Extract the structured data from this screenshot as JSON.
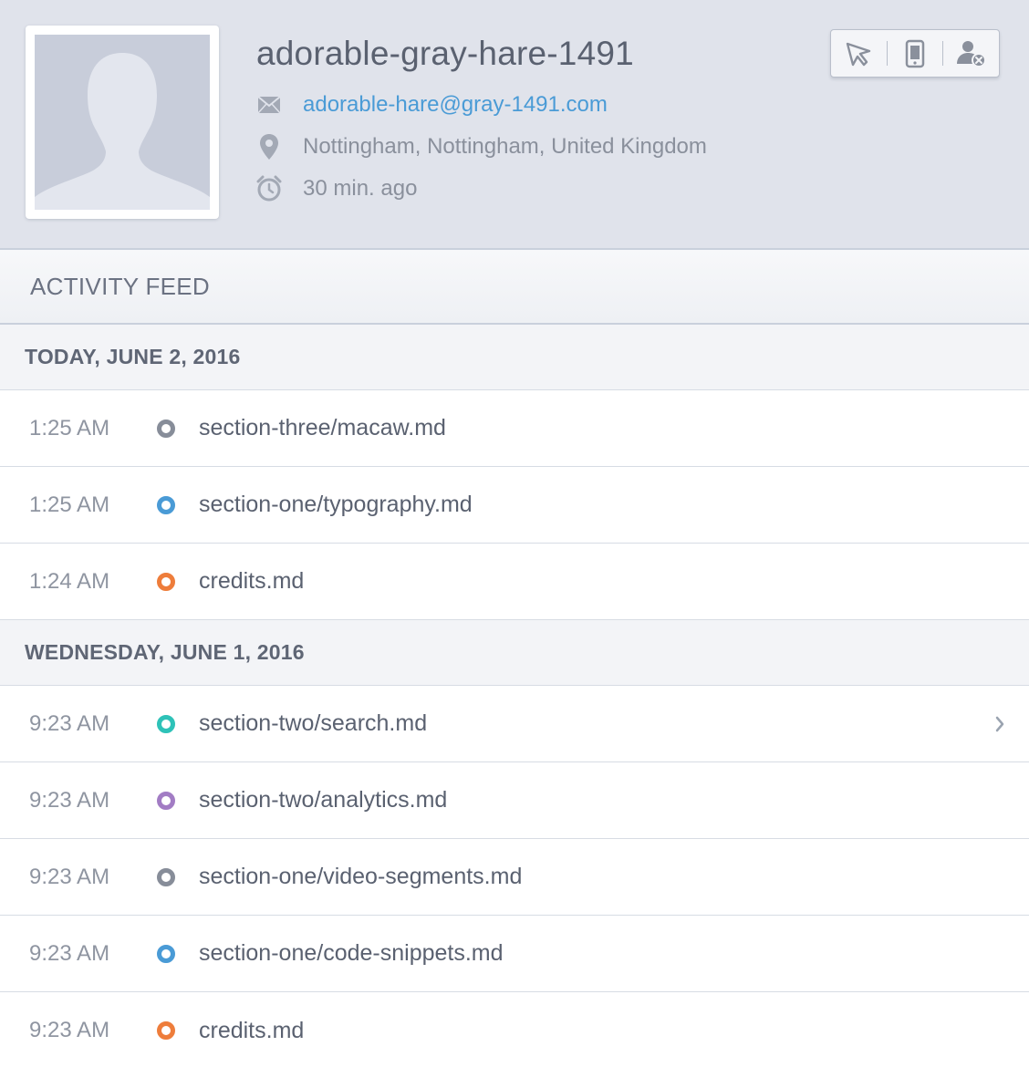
{
  "profile": {
    "name": "adorable-gray-hare-1491",
    "email": "adorable-hare@gray-1491.com",
    "location": "Nottingham, Nottingham, United Kingdom",
    "last_seen": "30 min. ago",
    "avatar_icon": "person-silhouette-icon",
    "toolbar": [
      {
        "icon": "send-cursor-icon"
      },
      {
        "icon": "mobile-device-icon"
      },
      {
        "icon": "remove-user-icon"
      }
    ]
  },
  "feed": {
    "title": "ACTIVITY FEED",
    "days": [
      {
        "label": "TODAY, JUNE 2, 2016",
        "items": [
          {
            "time": "1:25 AM",
            "file": "section-three/macaw.md",
            "dot_color": "#878d99"
          },
          {
            "time": "1:25 AM",
            "file": "section-one/typography.md",
            "dot_color": "#4a9bd6"
          },
          {
            "time": "1:24 AM",
            "file": "credits.md",
            "dot_color": "#ee7d3b"
          }
        ]
      },
      {
        "label": "WEDNESDAY, JUNE 1, 2016",
        "items": [
          {
            "time": "9:23 AM",
            "file": "section-two/search.md",
            "dot_color": "#2ec2b8",
            "chevron": "chevron-right-icon"
          },
          {
            "time": "9:23 AM",
            "file": "section-two/analytics.md",
            "dot_color": "#a27cc4"
          },
          {
            "time": "9:23 AM",
            "file": "section-one/video-segments.md",
            "dot_color": "#878d99"
          },
          {
            "time": "9:23 AM",
            "file": "section-one/code-snippets.md",
            "dot_color": "#4a9bd6"
          },
          {
            "time": "9:23 AM",
            "file": "credits.md",
            "dot_color": "#ee7d3b"
          }
        ]
      }
    ]
  }
}
